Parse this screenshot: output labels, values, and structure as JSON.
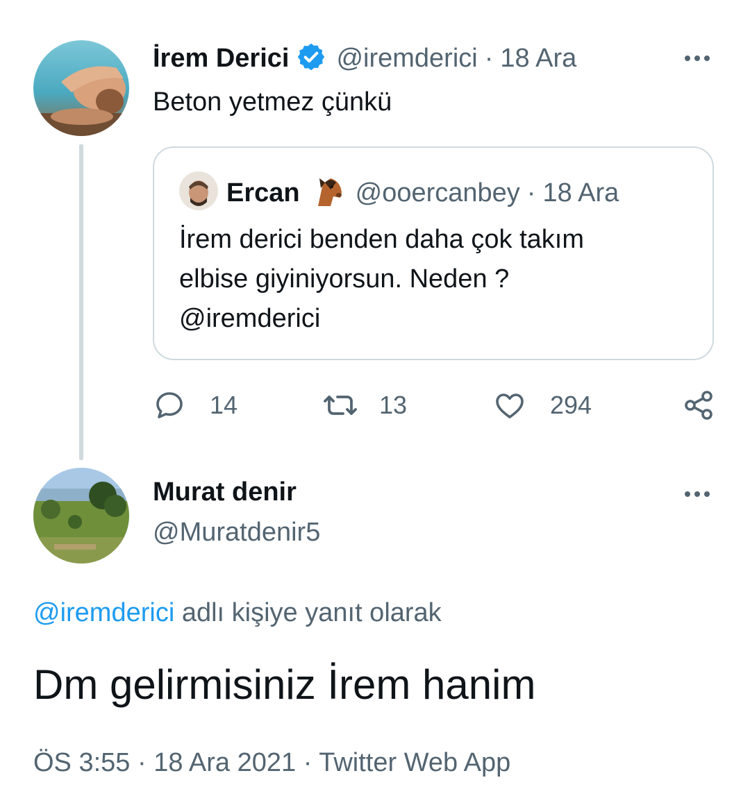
{
  "tweet": {
    "author": {
      "display_name": "İrem Derici",
      "handle": "@iremderici",
      "verified": true,
      "avatar": "profile-photo-beach"
    },
    "separator": "·",
    "date": "18 Ara",
    "text": "Beton yetmez çünkü",
    "quote": {
      "author": {
        "display_name": "Ercan",
        "emoji": "horse-face",
        "handle": "@ooercanbey"
      },
      "separator": "·",
      "date": "18 Ara",
      "lines": [
        "İrem derici benden daha çok takım",
        "elbise giyiniyorsun. Neden ?",
        "@iremderici"
      ]
    },
    "actions": {
      "replies": "14",
      "retweets": "13",
      "likes": "294"
    }
  },
  "reply": {
    "author": {
      "display_name": "Murat denir",
      "handle": "@Muratdenir5",
      "avatar": "profile-photo-landscape"
    },
    "reply_to": {
      "mention": "@iremderici",
      "suffix": " adlı kişiye yanıt olarak"
    },
    "text": "Dm gelirmisiniz İrem hanim",
    "meta": "ÖS 3:55 · 18 Ara 2021 · Twitter Web App"
  },
  "colors": {
    "verified_blue": "#1d9bf0",
    "secondary_text": "#536471",
    "border": "#cfd9de"
  }
}
